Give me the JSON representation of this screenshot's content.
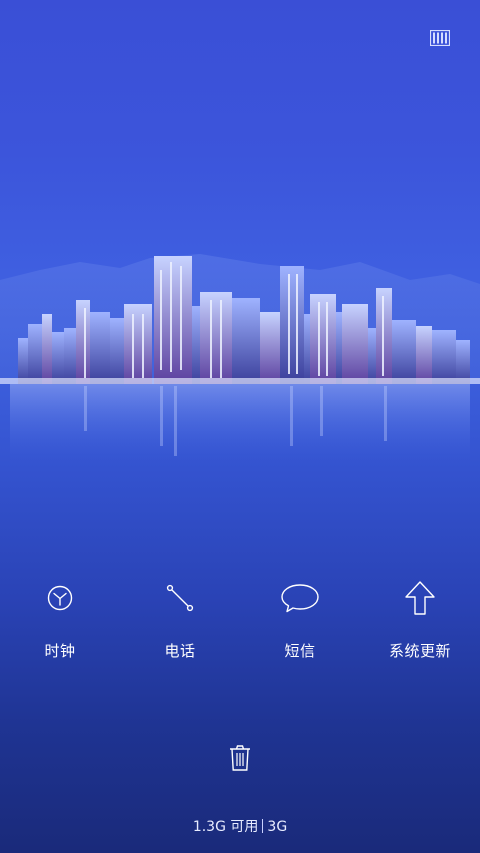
{
  "recents": {
    "icon": "recents-grid-icon"
  },
  "wallpaper": {
    "scene": "city-skyline-icon"
  },
  "dock": {
    "items": [
      {
        "label": "时钟",
        "icon": "clock-icon"
      },
      {
        "label": "电话",
        "icon": "phone-icon"
      },
      {
        "label": "短信",
        "icon": "message-bubble-icon"
      },
      {
        "label": "系统更新",
        "icon": "arrow-up-icon"
      }
    ]
  },
  "clear": {
    "icon": "trash-icon"
  },
  "memory": {
    "available": "1.3G 可用",
    "total": "3G"
  },
  "colors": {
    "bg_top": "#3a4fd6",
    "bg_bottom": "#1a2a7a",
    "icon_stroke": "#ffffff"
  }
}
